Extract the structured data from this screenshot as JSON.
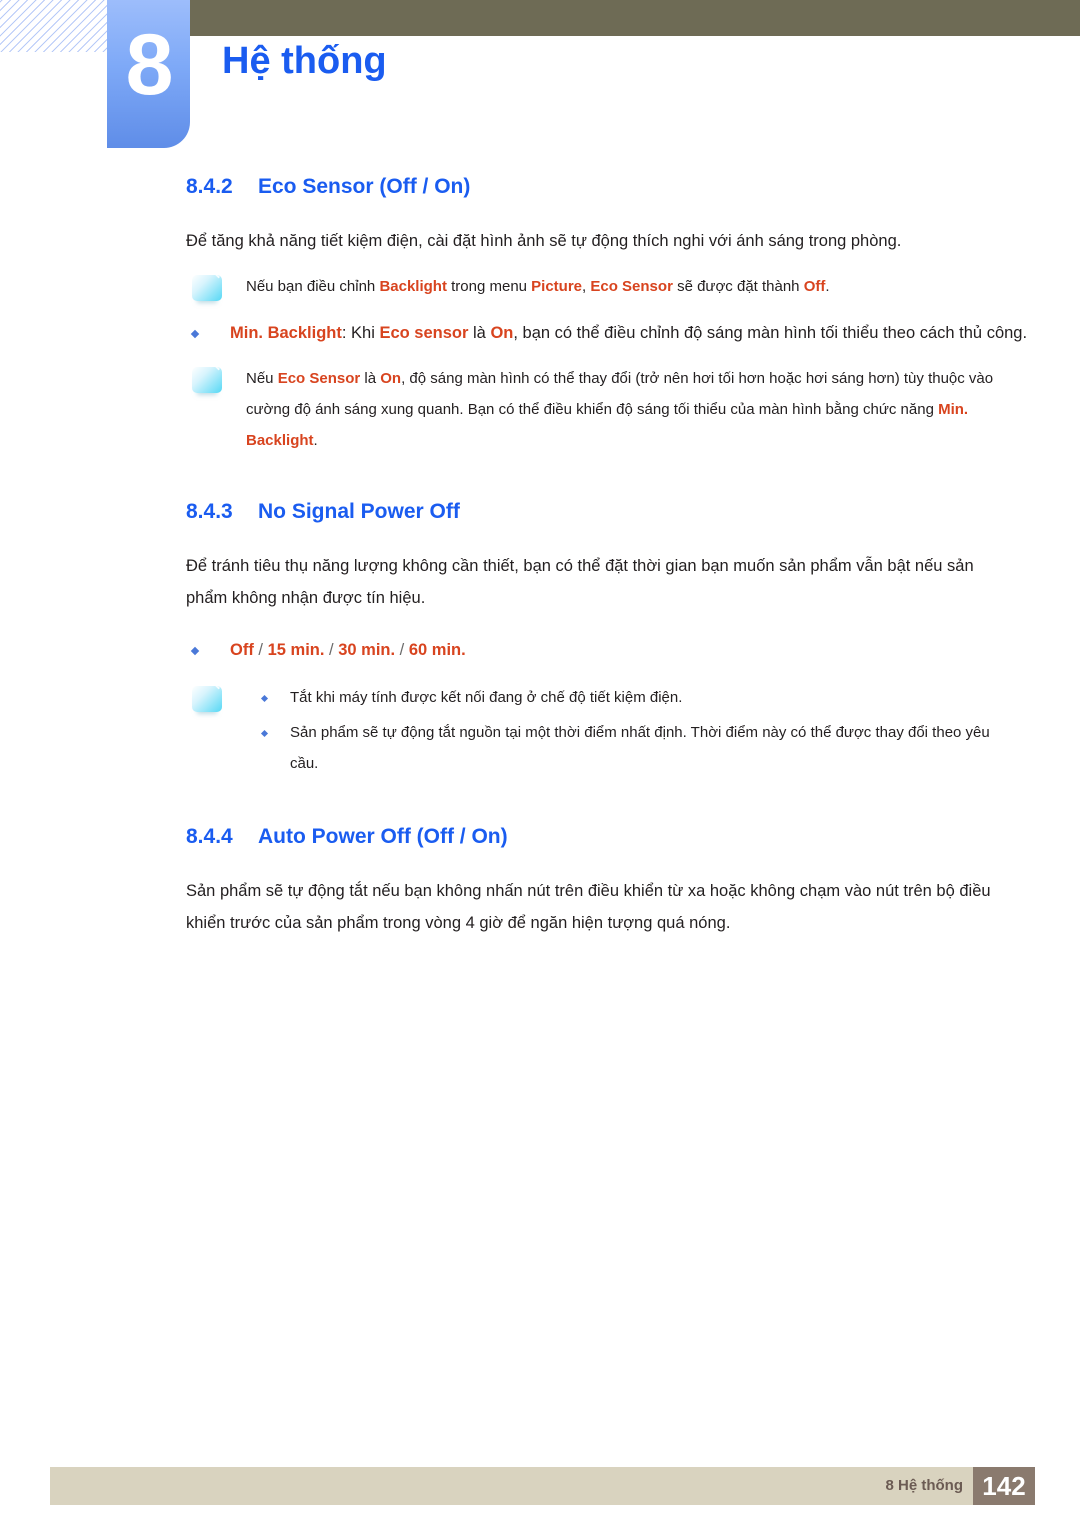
{
  "header": {
    "chapter_number": "8",
    "chapter_title": "Hệ thống"
  },
  "sections": [
    {
      "number": "8.4.2",
      "title": "Eco Sensor (Off / On)",
      "intro": "Để tăng khả năng tiết kiệm điện, cài đặt hình ảnh sẽ tự động thích nghi với ánh sáng trong phòng.",
      "note1": {
        "icon": "note-icon",
        "t1": "Nếu bạn điều chỉnh ",
        "kw1": "Backlight",
        "t2": " trong menu ",
        "kw2": "Picture",
        "t3": ", ",
        "kw3": "Eco Sensor",
        "t4": " sẽ được đặt thành ",
        "kw4": "Off",
        "t5": "."
      },
      "bullet": {
        "kw1": "Min. Backlight",
        "t1": ": Khi ",
        "kw2": "Eco sensor",
        "t2": " là ",
        "kw3": "On",
        "t3": ", bạn có thể điều chỉnh độ sáng màn hình tối thiểu theo cách thủ công."
      },
      "note2": {
        "icon": "note-icon",
        "t1": "Nếu ",
        "kw1": "Eco Sensor",
        "t2": " là ",
        "kw2": "On",
        "t3": ", độ sáng màn hình có thể thay đổi (trở nên hơi tối hơn hoặc hơi sáng hơn) tùy thuộc vào cường độ ánh sáng xung quanh. Bạn có thể điều khiển độ sáng tối thiểu của màn hình bằng chức năng ",
        "kw3": "Min. Backlight",
        "t4": "."
      }
    },
    {
      "number": "8.4.3",
      "title": "No Signal Power Off",
      "intro": "Để tránh tiêu thụ năng lượng không cần thiết, bạn có thể đặt thời gian bạn muốn sản phẩm vẫn bật nếu sản phẩm không nhận được tín hiệu.",
      "options": {
        "o1": "Off",
        "sep1": " / ",
        "o2": "15 min.",
        "sep2": " / ",
        "o3": "30 min.",
        "sep3": " / ",
        "o4": "60 min."
      },
      "note": {
        "icon": "note-icon",
        "item1": "Tắt khi máy tính được kết nối đang ở chế độ tiết kiệm điện.",
        "item2": "Sản phẩm sẽ tự động tắt nguồn tại một thời điểm nhất định. Thời điểm này có thể được thay đổi theo yêu cầu."
      }
    },
    {
      "number": "8.4.4",
      "title": "Auto Power Off (Off / On)",
      "intro": "Sản phẩm sẽ tự động tắt nếu bạn không nhấn nút trên điều khiển từ xa hoặc không chạm vào nút trên bộ điều khiển trước của sản phẩm trong vòng 4 giờ để ngăn hiện tượng quá nóng."
    }
  ],
  "footer": {
    "label": "8 Hệ thống",
    "page_number": "142"
  },
  "colors": {
    "heading_blue": "#1a5cf0",
    "keyword_orange": "#d8441f",
    "olive_bar": "#6e6b55",
    "footer_beige": "#d9d3bf",
    "page_box_brown": "#8a7a6e"
  }
}
